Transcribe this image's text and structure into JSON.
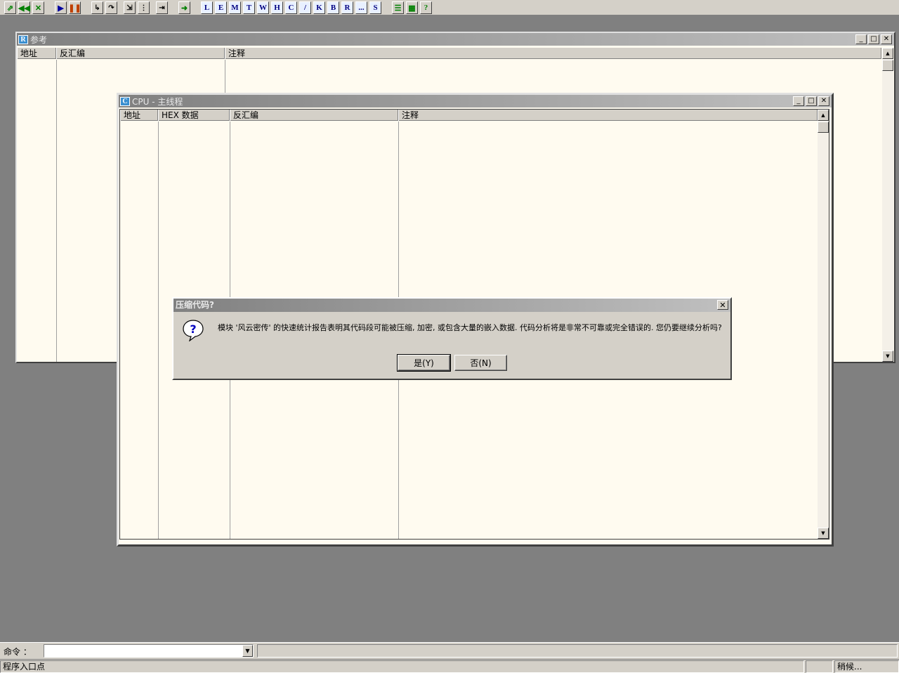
{
  "toolbar": {
    "buttons": [
      "L",
      "E",
      "M",
      "T",
      "W",
      "H",
      "C",
      "/",
      "K",
      "B",
      "R",
      "...",
      "S"
    ]
  },
  "ref_window": {
    "title": "参考",
    "icon_letter": "R",
    "columns": [
      "地址",
      "反汇编",
      "注释"
    ]
  },
  "cpu_window": {
    "title": "CPU - 主线程",
    "icon_letter": "C",
    "columns": [
      "地址",
      "HEX 数据",
      "反汇编",
      "注释"
    ]
  },
  "dialog": {
    "title": "压缩代码?",
    "message": "模块 '风云密传' 的快速统计报告表明其代码段可能被压缩, 加密, 或包含大量的嵌入数据. 代码分析将是非常不可靠或完全错误的. 您仍要继续分析吗?",
    "yes_label": "是(Y)",
    "no_label": "否(N)"
  },
  "command": {
    "label": "命令 ：",
    "value": ""
  },
  "status": {
    "left": "程序入口点",
    "right": "稍候..."
  }
}
